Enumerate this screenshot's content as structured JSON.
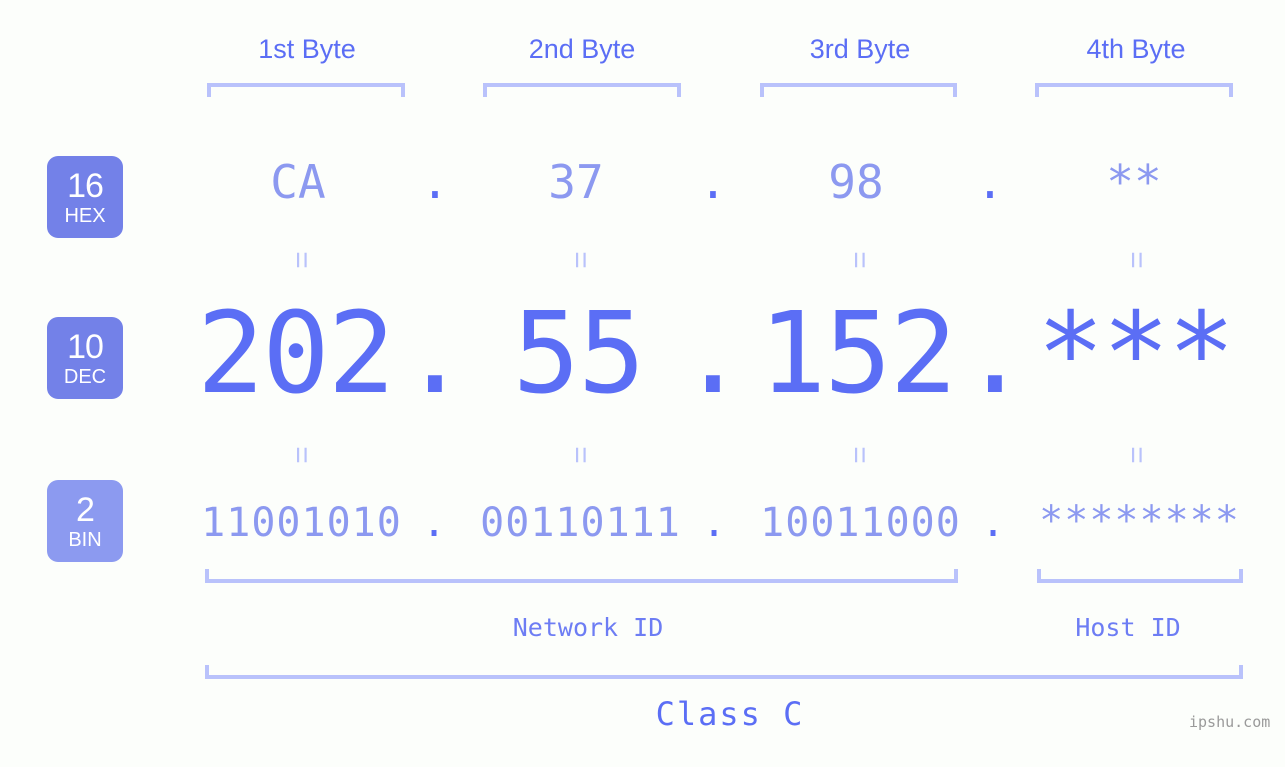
{
  "background_color": "#fcfefb",
  "accent_color": "#5b6ef5",
  "light_accent_color": "#8c99f0",
  "bracket_color": "#b9c2fb",
  "byte_headers": [
    {
      "label": "1st Byte"
    },
    {
      "label": "2nd Byte"
    },
    {
      "label": "3rd Byte"
    },
    {
      "label": "4th Byte"
    }
  ],
  "bases": [
    {
      "number": "16",
      "name": "HEX",
      "color": "#7381e8"
    },
    {
      "number": "10",
      "name": "DEC",
      "color": "#7381e8"
    },
    {
      "number": "2",
      "name": "BIN",
      "color": "#8c9af0"
    }
  ],
  "rows": {
    "hex": {
      "base_number": "16",
      "base_name": "HEX",
      "values": [
        "CA",
        "37",
        "98",
        "**"
      ],
      "separator": "."
    },
    "dec": {
      "base_number": "10",
      "base_name": "DEC",
      "values": [
        "202",
        "55",
        "152",
        "***"
      ],
      "separator": "."
    },
    "bin": {
      "base_number": "2",
      "base_name": "BIN",
      "values": [
        "11001010",
        "00110111",
        "10011000",
        "********"
      ],
      "separator": "."
    }
  },
  "equals_marker": "=",
  "sections": {
    "network_id": "Network ID",
    "host_id": "Host ID",
    "class": "Class C"
  },
  "watermark": "ipshu.com"
}
